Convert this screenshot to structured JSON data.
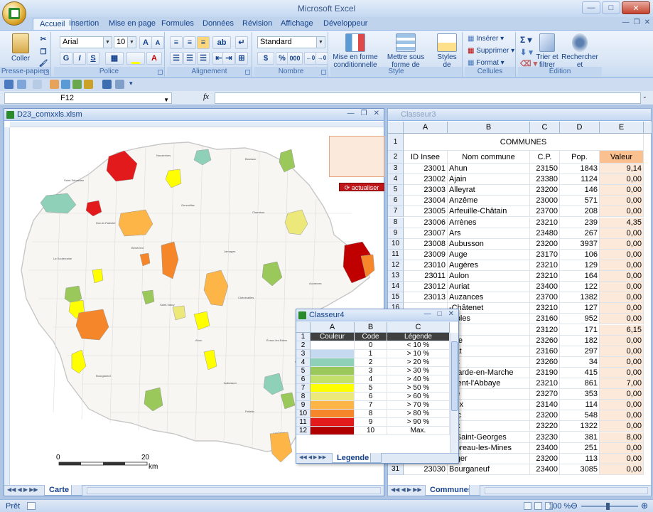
{
  "app": {
    "title": "Microsoft Excel",
    "tabs": [
      "Accueil",
      "Insertion",
      "Mise en page",
      "Formules",
      "Données",
      "Révision",
      "Affichage",
      "Développeur"
    ],
    "active_tab": "Accueil"
  },
  "ribbon": {
    "clipboard": {
      "paste_label": "Coller",
      "group_label": "Presse-papiers"
    },
    "font": {
      "font_name": "Arial",
      "font_size": "10",
      "bold": "G",
      "italic": "I",
      "underline": "S",
      "grow": "A",
      "shrink": "A",
      "font_color": "A",
      "group_label": "Police"
    },
    "alignment": {
      "group_label": "Alignement"
    },
    "number": {
      "format": "Standard",
      "percent": "%",
      "thousands": "000",
      "group_label": "Nombre"
    },
    "style": {
      "conditional_format_label": "Mise en forme conditionnelle",
      "table_format_label": "Mettre sous forme de tableau",
      "cell_styles_label": "Styles de cellules",
      "group_label": "Style"
    },
    "cells": {
      "insert_label": "Insérer",
      "delete_label": "Supprimer",
      "format_label": "Format",
      "group_label": "Cellules"
    },
    "editing": {
      "sort_filter_label": "Trier et filtrer",
      "find_select_label": "Rechercher et sélectionner",
      "group_label": "Édition"
    }
  },
  "formula_bar": {
    "name_box": "F12",
    "fx": "fx",
    "formula": ""
  },
  "map_window": {
    "title": "D23_comxxls.xlsm",
    "scale_start": "0",
    "scale_end": "20",
    "scale_unit": "km",
    "button_label": "actualiser",
    "sheet_tab": "Carte",
    "highlight_colors": {
      "red": "#e31a1c",
      "darkred": "#c00000",
      "orange": "#f5872a",
      "lightorange": "#fdb548",
      "yellow": "#ffff00",
      "paleyellow": "#ede87a",
      "green": "#9ac85a",
      "teal": "#8fd1b8",
      "base": "#f7f6f2"
    }
  },
  "classeur3": {
    "title": "Classeur3",
    "columns": [
      "A",
      "B",
      "C",
      "D",
      "E"
    ],
    "header_title": "COMMUNES",
    "headers": [
      "ID Insee",
      "Nom commune",
      "C.P.",
      "Pop.",
      "Valeur"
    ],
    "rows": [
      {
        "row": "3",
        "id": "23001",
        "name": "Ahun",
        "cp": "23150",
        "pop": "1843",
        "val": "9,14"
      },
      {
        "row": "4",
        "id": "23002",
        "name": "Ajain",
        "cp": "23380",
        "pop": "1124",
        "val": "0,00"
      },
      {
        "row": "5",
        "id": "23003",
        "name": "Alleyrat",
        "cp": "23200",
        "pop": "146",
        "val": "0,00"
      },
      {
        "row": "6",
        "id": "23004",
        "name": "Anzême",
        "cp": "23000",
        "pop": "571",
        "val": "0,00"
      },
      {
        "row": "7",
        "id": "23005",
        "name": "Arfeuille-Châtain",
        "cp": "23700",
        "pop": "208",
        "val": "0,00"
      },
      {
        "row": "8",
        "id": "23006",
        "name": "Arrènes",
        "cp": "23210",
        "pop": "239",
        "val": "4,35"
      },
      {
        "row": "9",
        "id": "23007",
        "name": "Ars",
        "cp": "23480",
        "pop": "267",
        "val": "0,00"
      },
      {
        "row": "10",
        "id": "23008",
        "name": "Aubusson",
        "cp": "23200",
        "pop": "3937",
        "val": "0,00"
      },
      {
        "row": "11",
        "id": "23009",
        "name": "Auge",
        "cp": "23170",
        "pop": "106",
        "val": "0,00"
      },
      {
        "row": "12",
        "id": "23010",
        "name": "Augères",
        "cp": "23210",
        "pop": "129",
        "val": "0,00"
      },
      {
        "row": "13",
        "id": "23011",
        "name": "Aulon",
        "cp": "23210",
        "pop": "164",
        "val": "0,00"
      },
      {
        "row": "14",
        "id": "23012",
        "name": "Auriat",
        "cp": "23400",
        "pop": "122",
        "val": "0,00"
      },
      {
        "row": "15",
        "id": "23013",
        "name": "Auzances",
        "cp": "23700",
        "pop": "1382",
        "val": "0,00"
      },
      {
        "row": "16",
        "id": "",
        "name": "-Châtenet",
        "cp": "23210",
        "pop": "127",
        "val": "0,00"
      },
      {
        "row": "17",
        "id": "",
        "name": "rables",
        "cp": "23160",
        "pop": "952",
        "val": "0,00"
      },
      {
        "row": "18",
        "id": "",
        "name": "ze",
        "cp": "23120",
        "pop": "171",
        "val": "6,15"
      },
      {
        "row": "19",
        "id": "",
        "name": "ville",
        "cp": "23260",
        "pop": "182",
        "val": "0,00"
      },
      {
        "row": "20",
        "id": "",
        "name": "elat",
        "cp": "23160",
        "pop": "297",
        "val": "0,00"
      },
      {
        "row": "21",
        "id": "",
        "name": "sat",
        "cp": "23260",
        "pop": "34",
        "val": "0,00"
      },
      {
        "row": "22",
        "id": "",
        "name": "egarde-en-Marche",
        "cp": "23190",
        "pop": "415",
        "val": "0,00"
      },
      {
        "row": "23",
        "id": "",
        "name": "évent-l'Abbaye",
        "cp": "23210",
        "pop": "861",
        "val": "7,00"
      },
      {
        "row": "24",
        "id": "",
        "name": "ète",
        "cp": "23270",
        "pop": "353",
        "val": "0,00"
      },
      {
        "row": "25",
        "id": "",
        "name": "deix",
        "cp": "23140",
        "pop": "114",
        "val": "0,00"
      },
      {
        "row": "26",
        "id": "",
        "name": "sac",
        "cp": "23200",
        "pop": "548",
        "val": "0,00"
      },
      {
        "row": "27",
        "id": "",
        "name": "nat",
        "cp": "23220",
        "pop": "1322",
        "val": "0,00"
      },
      {
        "row": "28",
        "id": "",
        "name": "d-Saint-Georges",
        "cp": "23230",
        "pop": "381",
        "val": "8,00"
      },
      {
        "row": "29",
        "id": "",
        "name": "moreau-les-Mines",
        "cp": "23400",
        "pop": "251",
        "val": "0,00"
      },
      {
        "row": "30",
        "id": "",
        "name": "roger",
        "cp": "23200",
        "pop": "113",
        "val": "0,00"
      },
      {
        "row": "31",
        "id": "23030",
        "name": "Bourganeuf",
        "cp": "23400",
        "pop": "3085",
        "val": "0,00"
      }
    ],
    "sheet_tab": "Communes"
  },
  "classeur4": {
    "title": "Classeur4",
    "columns": [
      "A",
      "B",
      "C"
    ],
    "headers": [
      "Couleur",
      "Code",
      "Légende"
    ],
    "rows": [
      {
        "row": "2",
        "color": "#ffffff",
        "code": "0",
        "legend": "< 10 %"
      },
      {
        "row": "3",
        "color": "#c5d9f1",
        "code": "1",
        "legend": "> 10 %"
      },
      {
        "row": "4",
        "color": "#8fd1b8",
        "code": "2",
        "legend": "> 20 %"
      },
      {
        "row": "5",
        "color": "#9ac85a",
        "code": "3",
        "legend": "> 30 %"
      },
      {
        "row": "6",
        "color": "#c3e06b",
        "code": "4",
        "legend": "> 40 %"
      },
      {
        "row": "7",
        "color": "#ffff00",
        "code": "5",
        "legend": "> 50 %"
      },
      {
        "row": "8",
        "color": "#ede87a",
        "code": "6",
        "legend": "> 60 %"
      },
      {
        "row": "9",
        "color": "#fdb548",
        "code": "7",
        "legend": "> 70 %"
      },
      {
        "row": "10",
        "color": "#f5872a",
        "code": "8",
        "legend": "> 80 %"
      },
      {
        "row": "11",
        "color": "#e31a1c",
        "code": "9",
        "legend": "> 90 %"
      },
      {
        "row": "12",
        "color": "#b00000",
        "code": "10",
        "legend": "Max."
      }
    ],
    "sheet_tab": "Legende"
  },
  "status": {
    "ready": "Prêt",
    "zoom": "100 %"
  }
}
